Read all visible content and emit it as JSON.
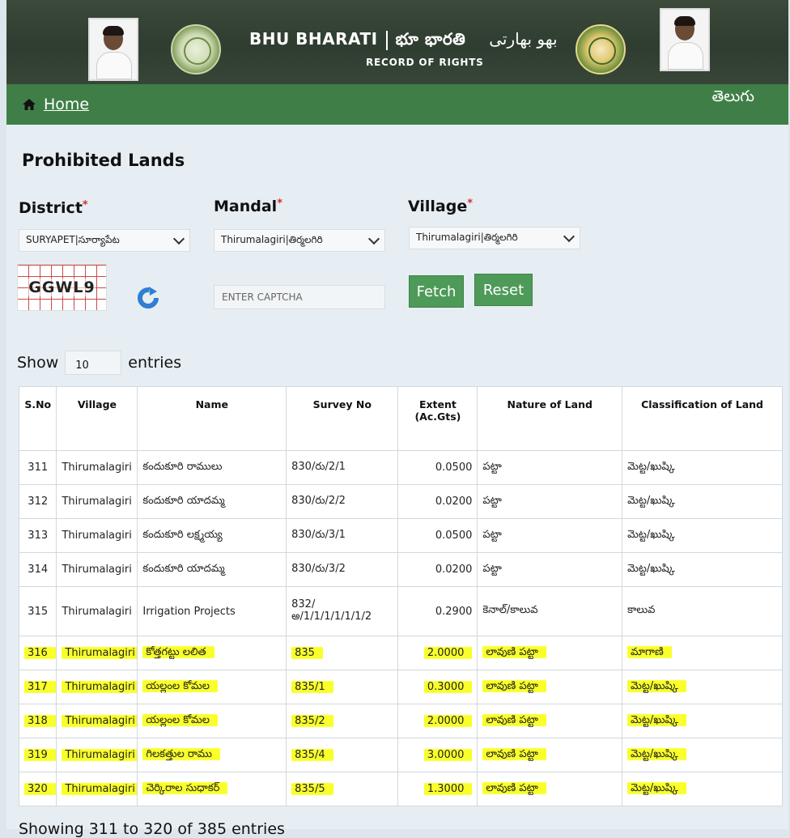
{
  "header": {
    "title_en": "BHU BHARATI",
    "title_te": "భూ భారతి",
    "title_ur": "بھو بھارتی",
    "subtitle": "RECORD OF RIGHTS"
  },
  "nav": {
    "home_label": "Home",
    "language_label": "తెలుగు"
  },
  "page": {
    "title": "Prohibited Lands"
  },
  "filters": {
    "district_label": "District",
    "district_value": "SURYAPET|సూర్యాపేట",
    "mandal_label": "Mandal",
    "mandal_value": "Thirumalagiri|తిర్మలగిరి",
    "village_label": "Village",
    "village_value": "Thirumalagiri|తిర్మలగిరి",
    "required_mark": "*",
    "captcha_text": "GGWL9",
    "captcha_placeholder": "ENTER CAPTCHA",
    "fetch_label": "Fetch",
    "reset_label": "Reset"
  },
  "table": {
    "show_label": "Show",
    "entries_value": "10",
    "entries_label": "entries",
    "columns": [
      "S.No",
      "Village",
      "Name",
      "Survey No",
      "Extent (Ac.Gts)",
      "Nature of Land",
      "Classification of Land"
    ],
    "rows": [
      {
        "sno": "311",
        "village": "Thirumalagiri",
        "name": "కందుకూరి రాములు",
        "survey": "830/రు/2/1",
        "extent": "0.0500",
        "nature": "పట్టా",
        "classification": "మెట్ట/ఖుష్కి",
        "highlighted": false
      },
      {
        "sno": "312",
        "village": "Thirumalagiri",
        "name": "కందుకూరి యాదమ్మ",
        "survey": "830/రు/2/2",
        "extent": "0.0200",
        "nature": "పట్టా",
        "classification": "మెట్ట/ఖుష్కి",
        "highlighted": false
      },
      {
        "sno": "313",
        "village": "Thirumalagiri",
        "name": "కందుకూరి లక్ష్మయ్య",
        "survey": "830/రు/3/1",
        "extent": "0.0500",
        "nature": "పట్టా",
        "classification": "మెట్ట/ఖుష్కి",
        "highlighted": false
      },
      {
        "sno": "314",
        "village": "Thirumalagiri",
        "name": "కందుకూరి యాదమ్మ",
        "survey": "830/రు/3/2",
        "extent": "0.0200",
        "nature": "పట్టా",
        "classification": "మెట్ట/ఖుష్కి",
        "highlighted": false
      },
      {
        "sno": "315",
        "village": "Thirumalagiri",
        "name": "Irrigation Projects",
        "survey": "832/ అ/1/1/1/1/1/1/2",
        "extent": "0.2900",
        "nature": "కెనాల్/కాలువ",
        "classification": "కాలువ",
        "highlighted": false
      },
      {
        "sno": "316",
        "village": "Thirumalagiri",
        "name": "కోత్తగట్టు లలిత",
        "survey": "835",
        "extent": "2.0000",
        "nature": "లావుణి పట్టా",
        "classification": "మాగాణి",
        "highlighted": true
      },
      {
        "sno": "317",
        "village": "Thirumalagiri",
        "name": "యల్లంల కోమల",
        "survey": "835/1",
        "extent": "0.3000",
        "nature": "లావుణి పట్టా",
        "classification": "మెట్ట/ఖుష్కి",
        "highlighted": true
      },
      {
        "sno": "318",
        "village": "Thirumalagiri",
        "name": "యల్లంల కోమల",
        "survey": "835/2",
        "extent": "2.0000",
        "nature": "లావుణి పట్టా",
        "classification": "మెట్ట/ఖుష్కి",
        "highlighted": true
      },
      {
        "sno": "319",
        "village": "Thirumalagiri",
        "name": "గిలకత్తుల రాము",
        "survey": "835/4",
        "extent": "3.0000",
        "nature": "లావుణి పట్టా",
        "classification": "మెట్ట/ఖుష్కి",
        "highlighted": true
      },
      {
        "sno": "320",
        "village": "Thirumalagiri",
        "name": "చెర్కిరాల సుధాకర్",
        "survey": "835/5",
        "extent": "1.3000",
        "nature": "లావుణి పట్టా",
        "classification": "మెట్ట/ఖుష్కి",
        "highlighted": true
      }
    ],
    "footer_text": "Showing 311 to 320 of 385 entries"
  },
  "colors": {
    "nav_green": "#3f7f47",
    "button_green": "#4e9a59",
    "required_red": "#d32f2f",
    "highlight_yellow": "#f7ff2c"
  }
}
